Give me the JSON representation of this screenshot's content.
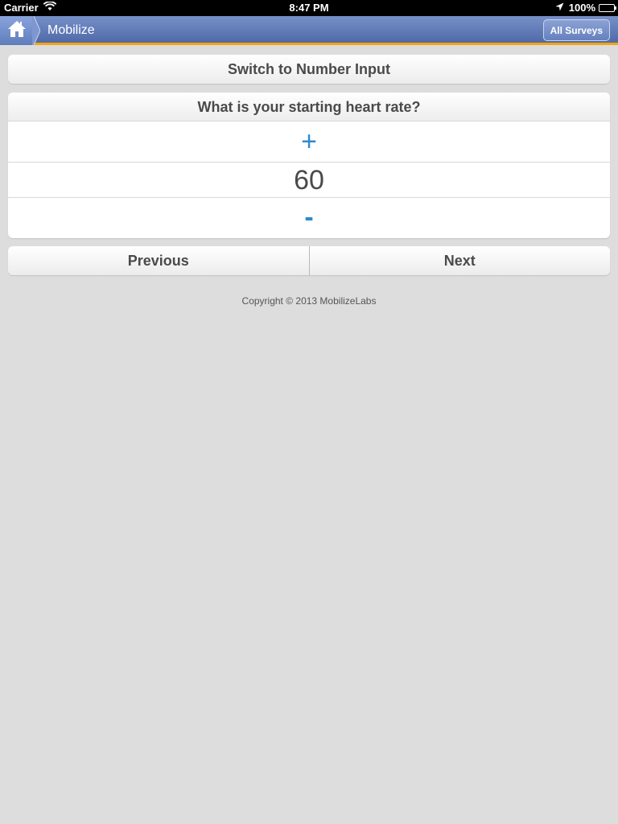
{
  "status_bar": {
    "carrier": "Carrier",
    "time": "8:47 PM",
    "battery": "100%"
  },
  "header": {
    "title": "Mobilize",
    "all_surveys_label": "All Surveys"
  },
  "switch_button_label": "Switch to Number Input",
  "question": {
    "title": "What is your starting heart rate?",
    "plus_label": "+",
    "value": "60",
    "minus_label": "-"
  },
  "navigation": {
    "previous_label": "Previous",
    "next_label": "Next"
  },
  "footer": {
    "copyright": "Copyright © 2013 MobilizeLabs"
  },
  "colors": {
    "header_accent": "#f5a40f",
    "stepper_blue": "#2e8ad0",
    "header_blue": "#4f6aa8"
  }
}
